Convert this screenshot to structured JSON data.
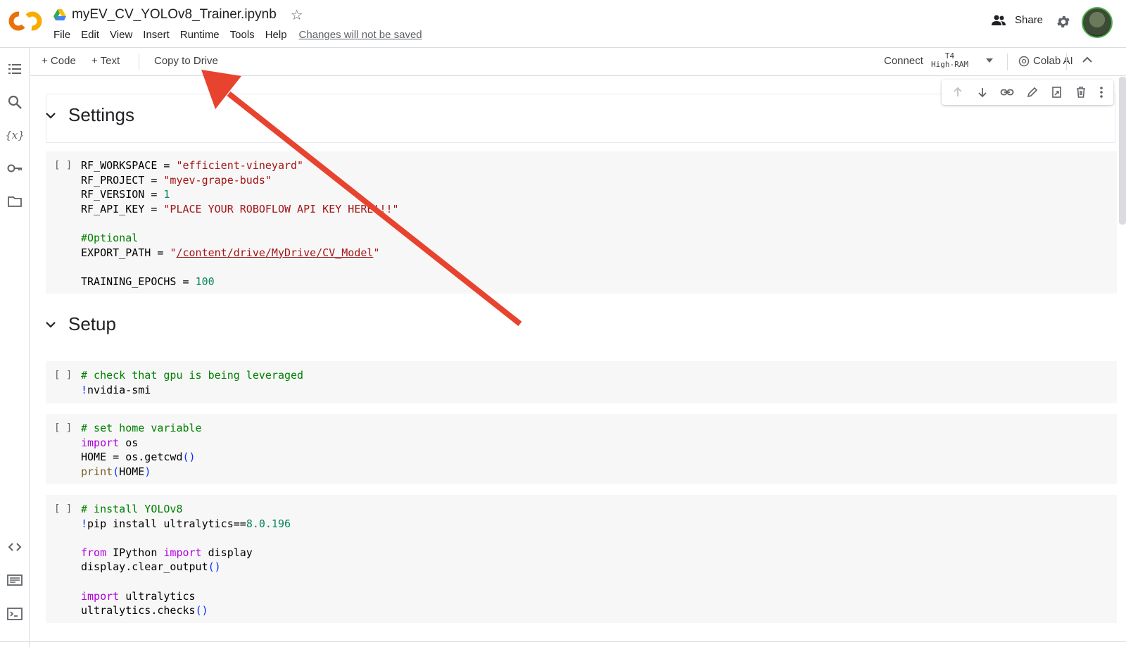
{
  "header": {
    "notebook_title": "myEV_CV_YOLOv8_Trainer.ipynb",
    "menu": [
      "File",
      "Edit",
      "View",
      "Insert",
      "Runtime",
      "Tools",
      "Help"
    ],
    "unsaved_notice": "Changes will not be saved",
    "share_label": "Share"
  },
  "toolbar": {
    "add_code": "+ Code",
    "add_text": "+ Text",
    "copy_to_drive": "Copy to Drive",
    "connect": "Connect",
    "runtime_gpu": "T4",
    "runtime_ram": "High-RAM",
    "colab_ai": "Colab AI"
  },
  "sidebar": {
    "icons": [
      "table-of-contents-icon",
      "search-icon",
      "variables-icon",
      "secrets-key-icon",
      "files-folder-icon",
      "code-snippets-icon",
      "command-palette-icon",
      "terminal-icon"
    ]
  },
  "sections": {
    "settings": "Settings",
    "setup": "Setup"
  },
  "cells": {
    "bracket": "[ ]"
  },
  "colors": {
    "arrow": "#e8432e",
    "logo_orange": "#f9ab00",
    "logo_dark_orange": "#e8710a"
  }
}
